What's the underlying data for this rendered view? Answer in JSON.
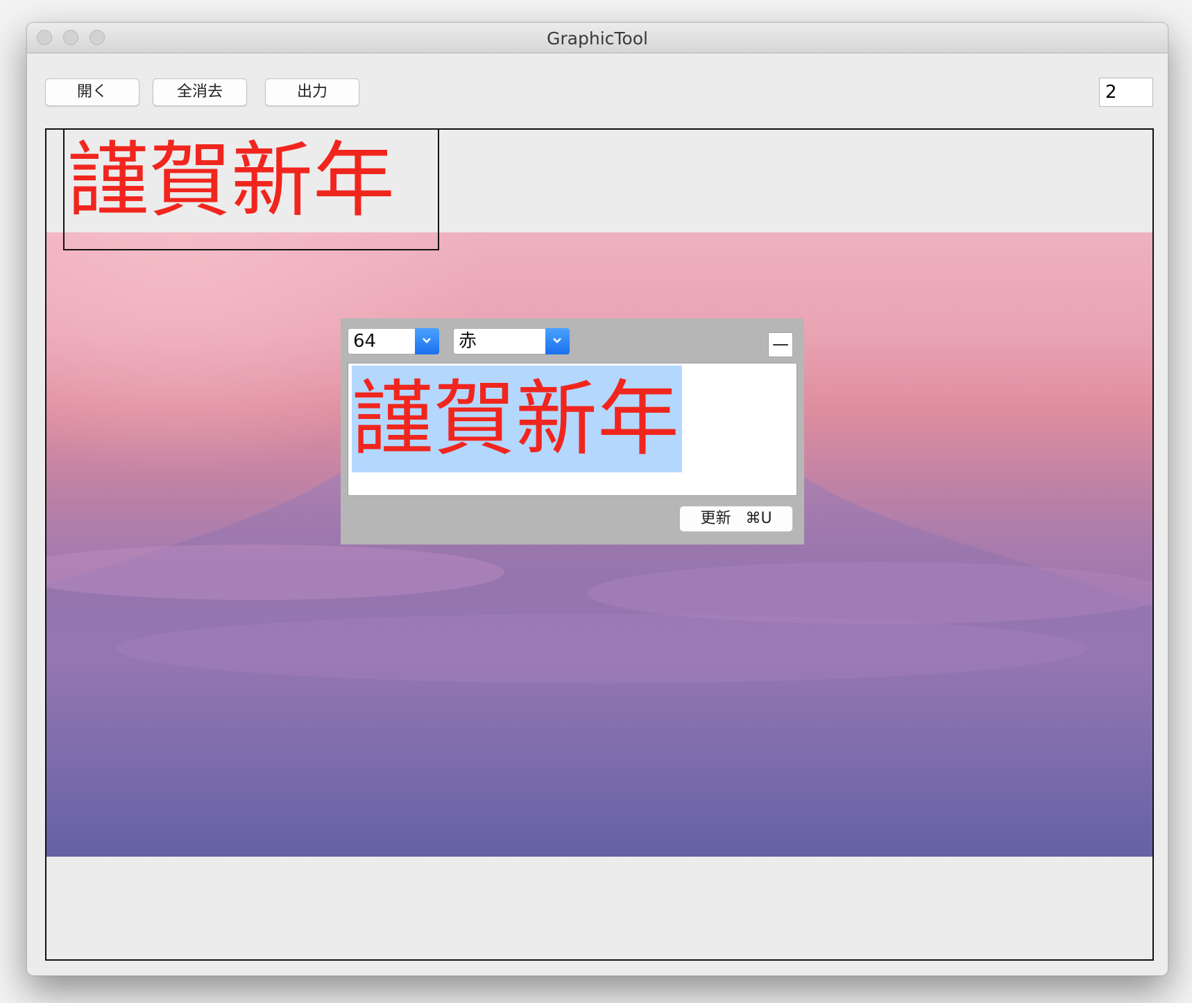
{
  "window": {
    "title": "GraphicTool"
  },
  "toolbar": {
    "open_label": "開く",
    "clear_all_label": "全消去",
    "export_label": "出力",
    "page_value": "2"
  },
  "canvas": {
    "text": "謹賀新年",
    "text_color": "#f0261e"
  },
  "editor": {
    "font_size_value": "64",
    "color_value": "赤",
    "minus_label": "—",
    "text_value": "謹賀新年",
    "update_label": "更新",
    "update_shortcut": "⌘U"
  },
  "icons": {
    "window_controls": [
      "close-icon",
      "minimize-icon",
      "zoom-icon"
    ],
    "dropdown": "chevron-down-icon"
  }
}
